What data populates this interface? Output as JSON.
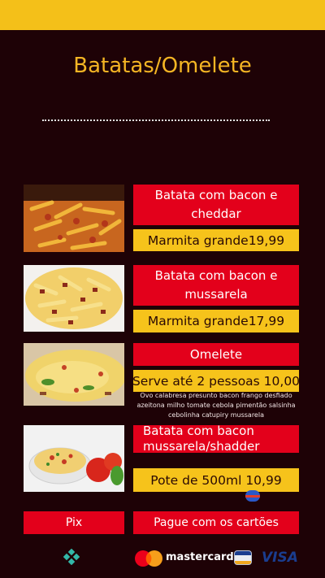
{
  "page": {
    "title": "Batatas/Omelete"
  },
  "items": [
    {
      "name": "Batata com bacon e cheddar",
      "price_label": "Marmita grande19,99"
    },
    {
      "name": "Batata com bacon e mussarela",
      "price_label": "Marmita grande17,99"
    },
    {
      "name": "Omelete",
      "price_label": "Serve até 2 pessoas 10,00",
      "description": "Ovo calabresa presunto bacon frango desfiado azeitona milho tomate cebola pimentão salsinha cebolinha catupiry mussarela"
    },
    {
      "name": "Batata com bacon mussarela/shadder",
      "price_label": "Pote de 500ml 10,99"
    }
  ],
  "payment": {
    "pix_label": "Pix",
    "cards_label": "Pague com os cartões",
    "mastercard_label": "mastercard",
    "visa_label": "VISA"
  },
  "colors": {
    "background": "#1e0206",
    "accent_yellow": "#f4c019",
    "accent_red": "#e3001b",
    "title": "#f4b524"
  }
}
